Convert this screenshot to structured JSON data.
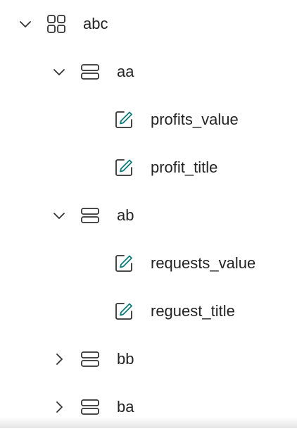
{
  "colors": {
    "text": "#242424",
    "icon_stroke": "#323232",
    "edit_accent": "#0f7b7a"
  },
  "tree": {
    "root": {
      "label": "abc",
      "icon": "dashboard-grid-icon",
      "expanded": true
    },
    "groups": [
      {
        "label": "aa",
        "icon": "table-rows-icon",
        "expanded": true,
        "children": [
          {
            "label": "profits_value",
            "icon": "edit-square-icon"
          },
          {
            "label": "profit_title",
            "icon": "edit-square-icon"
          }
        ]
      },
      {
        "label": "ab",
        "icon": "table-rows-icon",
        "expanded": true,
        "children": [
          {
            "label": "requests_value",
            "icon": "edit-square-icon"
          },
          {
            "label": "reguest_title",
            "icon": "edit-square-icon"
          }
        ]
      },
      {
        "label": "bb",
        "icon": "table-rows-icon",
        "expanded": false
      },
      {
        "label": "ba",
        "icon": "table-rows-icon",
        "expanded": false
      }
    ]
  }
}
